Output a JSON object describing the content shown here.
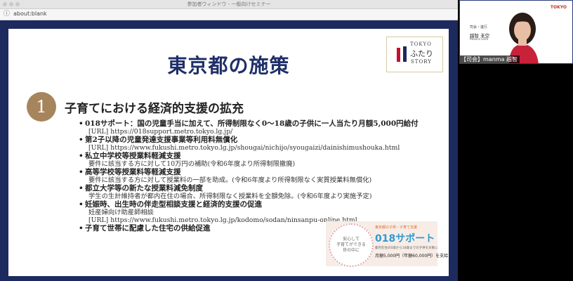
{
  "window": {
    "title": "参加者ウィンドウ - 一般向けセミナー",
    "address": "about:blank",
    "traffic_colors": [
      "#c9c9c9",
      "#c9c9c9",
      "#c9c9c9"
    ]
  },
  "slide": {
    "title": "東京都の施策",
    "logo": {
      "line1": "TOKYO",
      "line2": "ふたり",
      "line3": "STORY"
    },
    "section_number": "1",
    "section_title": "子育てにおける経済的支援の拡充",
    "items": [
      {
        "title": "018サポート：国の児童手当に加えて、所得制限なく0～18歳の子供に一人当たり月額5,000円給付",
        "sub": "[URL] https://018support.metro.tokyo.lg.jp/",
        "sub2": ""
      },
      {
        "title": "第2子以降の児童発達支援事業等利用料無償化",
        "sub": "[URL] https://www.fukushi.metro.tokyo.lg.jp/shougai/nichijo/syougaizi/dainishimushouka.html",
        "sub2": ""
      },
      {
        "title": "私立中学校等授業料軽減支援",
        "sub": "要件に該当する方に対して10万円の補助(令和6年度より所得制限撤廃)",
        "sub2": ""
      },
      {
        "title": "高等学校等授業料等軽減支援",
        "sub": "要件に該当する方に対して授業料の一部を助成。(令和6年度より所得制限なく実質授業料無償化)",
        "sub2": ""
      },
      {
        "title": "都立大学等の新たな授業料減免制度",
        "sub": "学生の生計維持者が都内在住の場合、所得制限なく授業料を全額免除。(令和6年度より実施予定)",
        "sub2": ""
      },
      {
        "title": "妊娠時、出生時の伴走型相談支援と経済的支援の促進",
        "sub": "妊産婦向け助産師相談",
        "sub2": "[URL] https://www.fukushi.metro.tokyo.lg.jp/kodomo/sodan/ninsanpu-online.html"
      },
      {
        "title": "子育て世帯に配慮した住宅の供給促進",
        "sub": "",
        "sub2": ""
      }
    ],
    "banner": {
      "circle_text": [
        "安心して",
        "子育てができる",
        "世の中に"
      ],
      "caption": "東京都の子供・子育て支援",
      "logo_text": "018サポート",
      "desc": "都内在住の0歳から18歳までの子供を対象に",
      "amount": "月額5,000円（年額60,000円）を支給"
    }
  },
  "camera": {
    "logo": "TOKYO",
    "role": "司会・進行",
    "name": "越智 未空",
    "name_en": "Misora Ochi",
    "label": "【司会】manma 越智"
  }
}
